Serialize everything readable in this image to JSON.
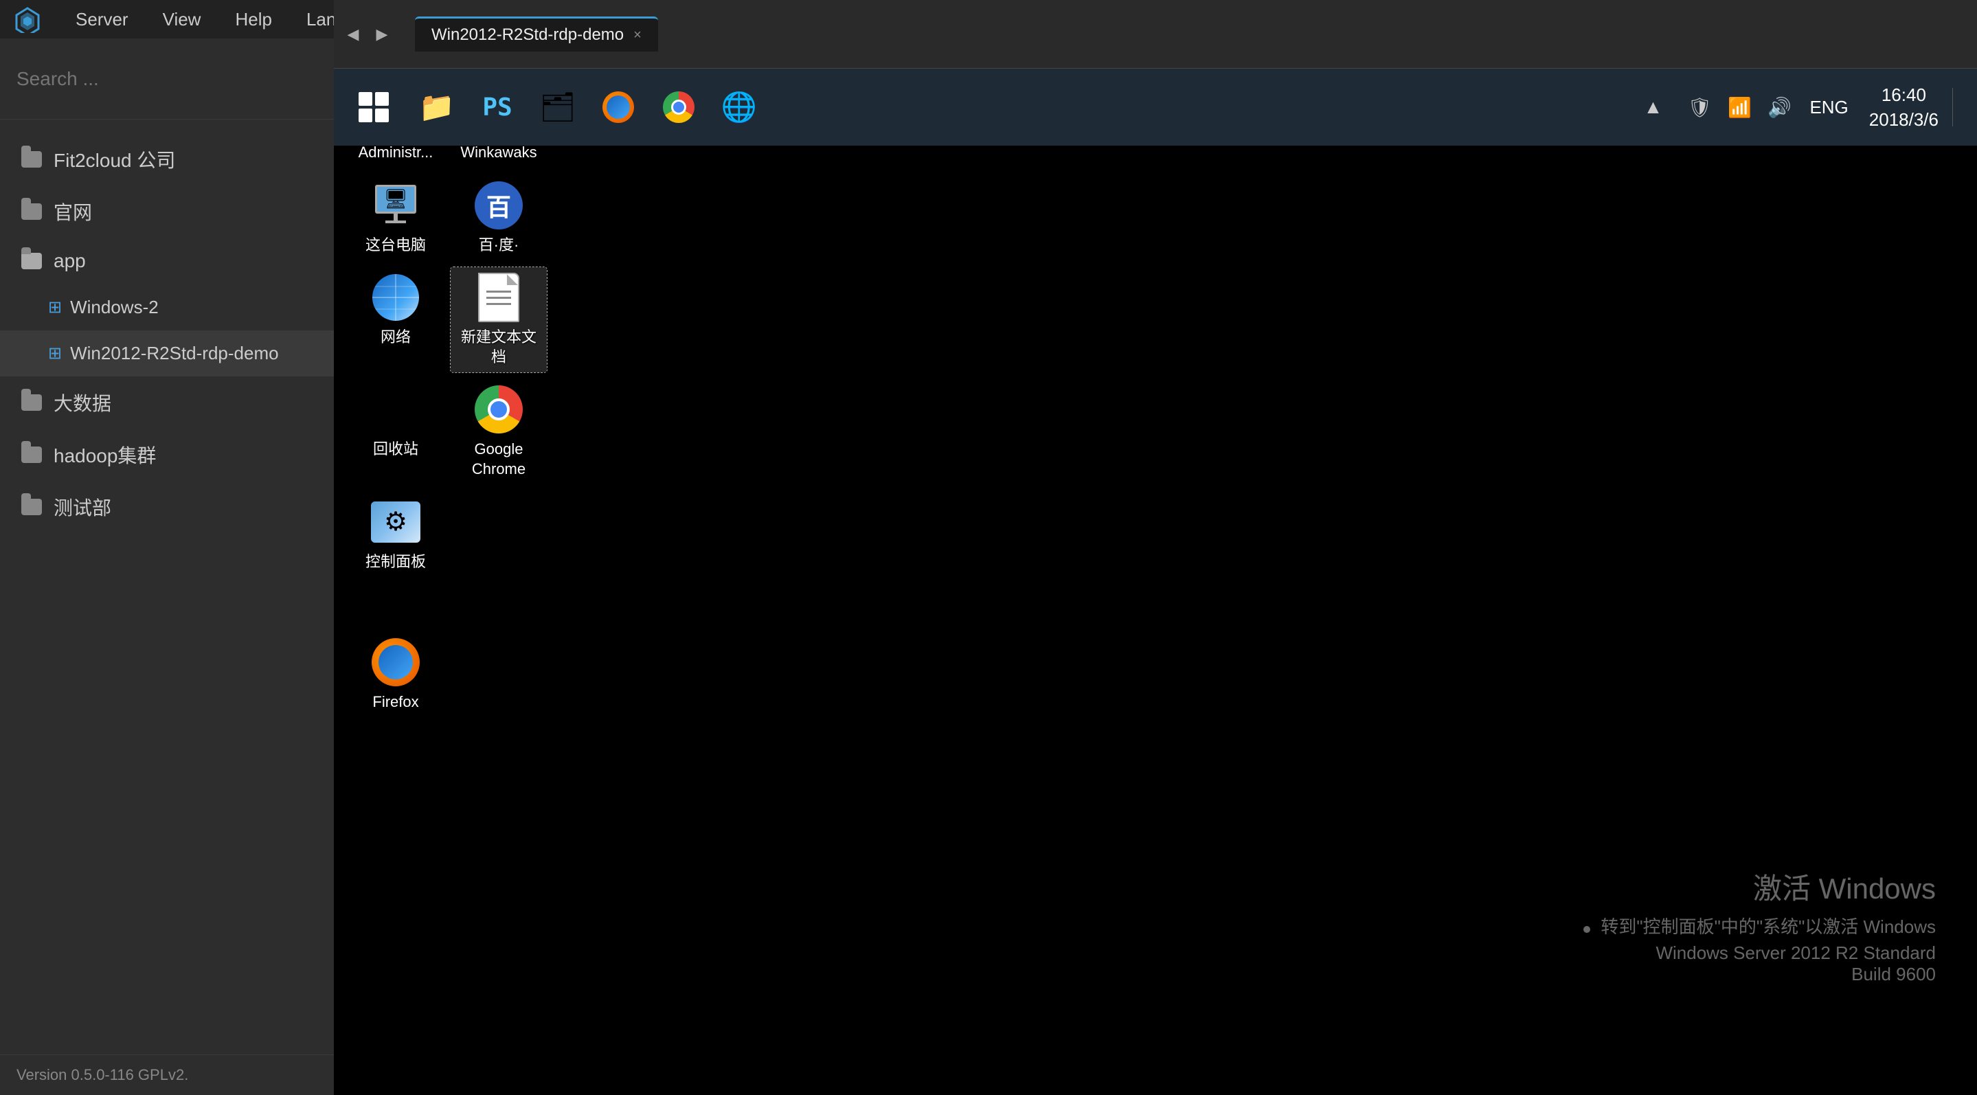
{
  "sidebar": {
    "search_placeholder": "Search ...",
    "menu_items": [
      {
        "label": "Server",
        "key": "server"
      },
      {
        "label": "View",
        "key": "view"
      },
      {
        "label": "Help",
        "key": "help"
      },
      {
        "label": "Language",
        "key": "language"
      }
    ],
    "nav_items": [
      {
        "label": "Fit2cloud 公司",
        "type": "folder",
        "indent": 0
      },
      {
        "label": "官网",
        "type": "folder",
        "indent": 0
      },
      {
        "label": "app",
        "type": "folder",
        "indent": 0
      },
      {
        "label": "Windows-2",
        "type": "windows",
        "indent": 1
      },
      {
        "label": "Win2012-R2Std-rdp-demo",
        "type": "windows",
        "indent": 1
      },
      {
        "label": "大数据",
        "type": "folder",
        "indent": 0
      },
      {
        "label": "hadoop集群",
        "type": "folder",
        "indent": 0
      },
      {
        "label": "测试部",
        "type": "folder",
        "indent": 0
      }
    ]
  },
  "tab": {
    "label": "Win2012-R2Std-rdp-demo",
    "close_label": "×"
  },
  "app_info": {
    "version": "Version 0.5.0-116 GPLv2."
  },
  "desktop_icons": [
    {
      "label": "Administr...",
      "type": "folder_admin",
      "row": 0,
      "col": 0
    },
    {
      "label": "Winkawaks",
      "type": "folder_winkawaks",
      "row": 0,
      "col": 1
    },
    {
      "label": "这台电脑",
      "type": "computer",
      "row": 1,
      "col": 0
    },
    {
      "label": "百·度·",
      "type": "baidu",
      "row": 1,
      "col": 1
    },
    {
      "label": "网络",
      "type": "network",
      "row": 2,
      "col": 0
    },
    {
      "label": "新建文本文\n档",
      "type": "text_doc",
      "row": 2,
      "col": 1,
      "selected": true
    },
    {
      "label": "回收站",
      "type": "recycle",
      "row": 3,
      "col": 0
    },
    {
      "label": "Google\nChrome",
      "type": "chrome",
      "row": 3,
      "col": 1
    },
    {
      "label": "控制面板",
      "type": "control_panel",
      "row": 4,
      "col": 0
    },
    {
      "label": "Firefox",
      "type": "firefox",
      "row": 6,
      "col": 0
    }
  ],
  "activation": {
    "title": "激活 Windows",
    "subtitle": "转到\"控制面板\"中的\"系统\"以激活 Windows",
    "os_name": "Windows Server 2012 R2 Standard",
    "build": "Build 9600"
  },
  "taskbar": {
    "lang": "ENG",
    "time": "16:40",
    "date": "2018/3/6"
  },
  "nav_arrows": {
    "left": "◀",
    "right": "▶"
  }
}
